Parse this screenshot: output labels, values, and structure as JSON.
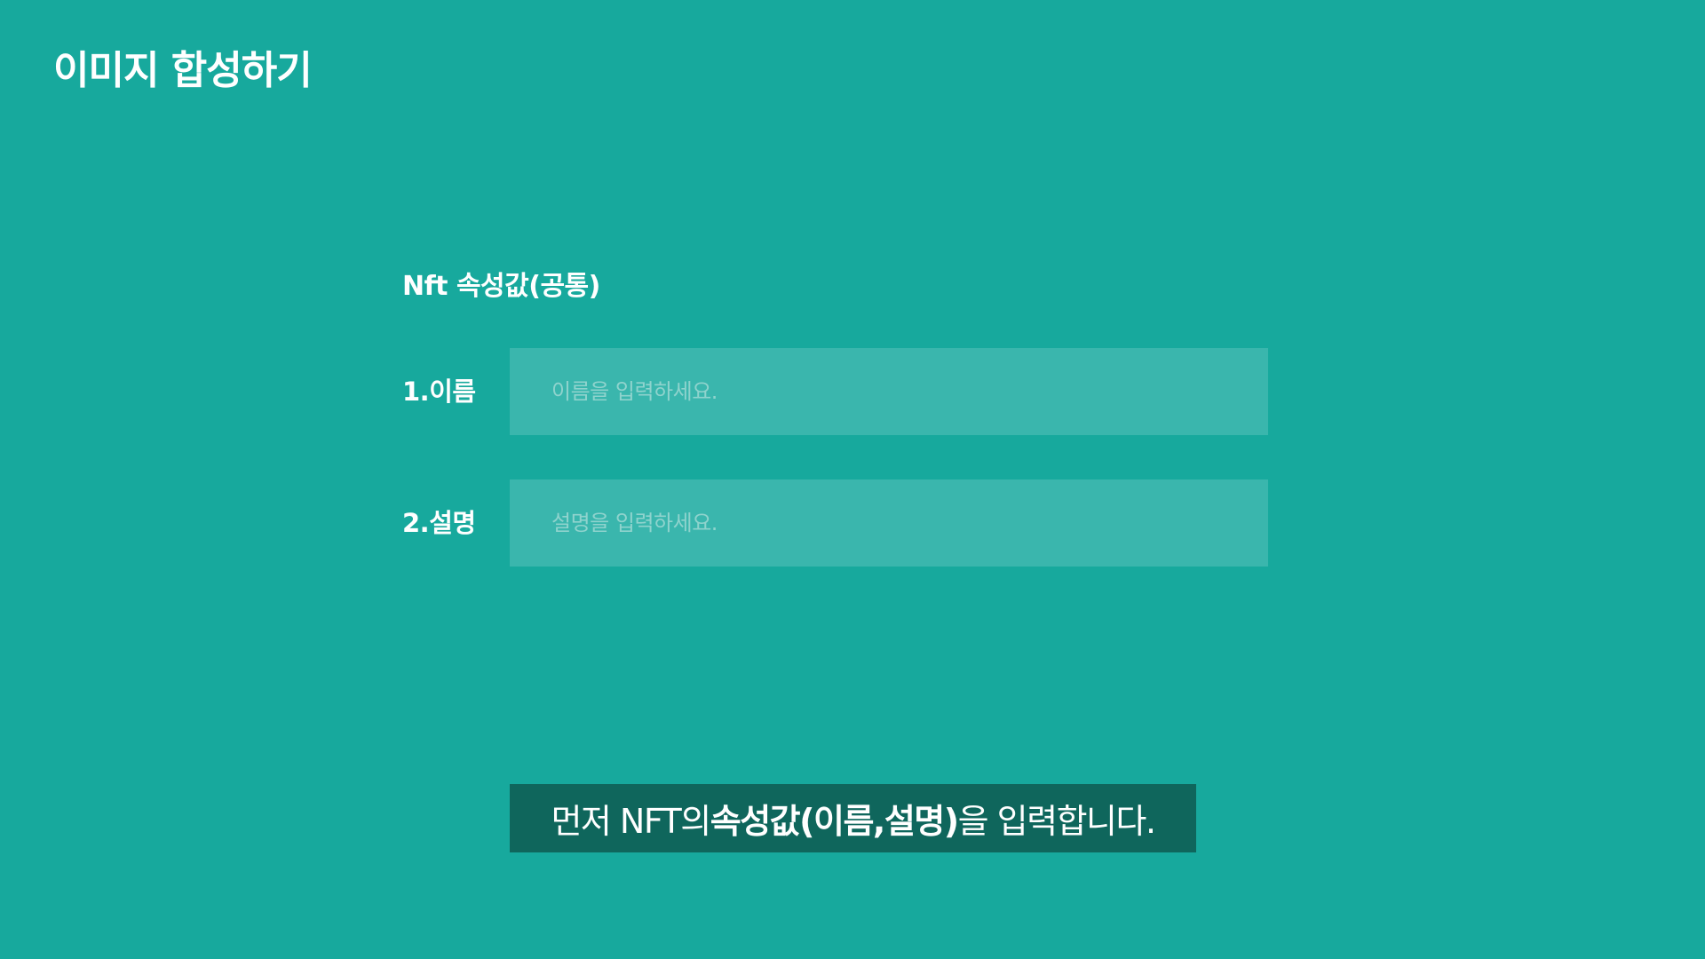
{
  "page": {
    "title": "이미지 합성하기"
  },
  "form": {
    "section_title": "Nft 속성값(공통)",
    "fields": [
      {
        "label": "1.이름",
        "placeholder": "이름을 입력하세요.",
        "value": ""
      },
      {
        "label": "2.설명",
        "placeholder": "설명을 입력하세요.",
        "value": ""
      }
    ]
  },
  "caption": {
    "prefix": "먼저 NFT의 ",
    "emphasis": "속성값(이름,설명)",
    "suffix": "을 입력합니다."
  },
  "colors": {
    "background": "#17a99d",
    "input_background": "#3ab6ad",
    "caption_background": "#0f665c",
    "text": "#ffffff",
    "placeholder": "#8fd3cd"
  }
}
